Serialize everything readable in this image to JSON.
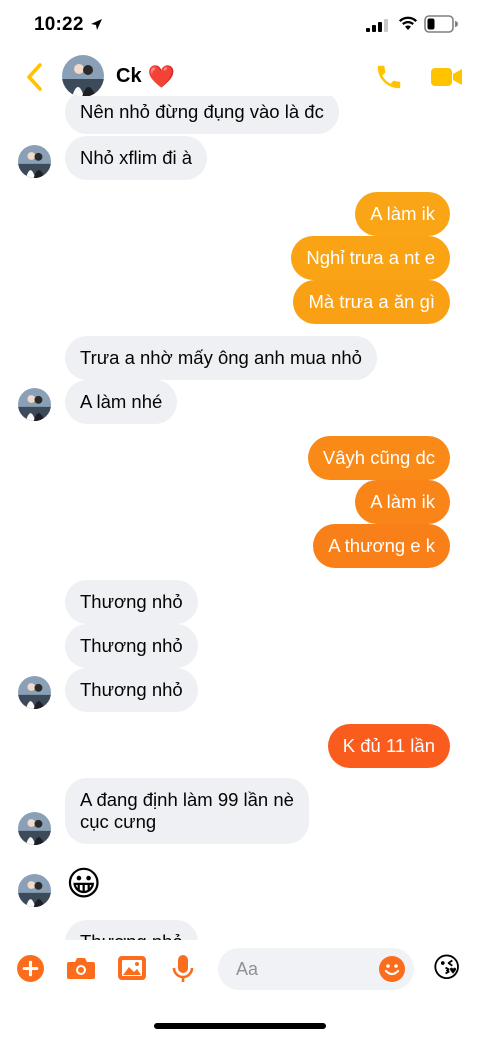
{
  "status": {
    "time": "10:22"
  },
  "header": {
    "contact_name": "Ck",
    "heart": "❤️"
  },
  "messages": [
    {
      "side": "in",
      "text": "Nên nhỏ đừng đụng vào là đc"
    },
    {
      "side": "in",
      "text": "Nhỏ xflim đi à"
    },
    {
      "side": "out",
      "text": "A làm ik"
    },
    {
      "side": "out",
      "text": "Nghỉ trưa a nt e"
    },
    {
      "side": "out",
      "text": "Mà trưa a ăn gì"
    },
    {
      "side": "in",
      "text": "Trưa a nhờ mấy ông anh mua nhỏ"
    },
    {
      "side": "in",
      "text": "A làm nhé"
    },
    {
      "side": "out",
      "text": "Vâyh cũng dc"
    },
    {
      "side": "out",
      "text": "A làm ik"
    },
    {
      "side": "out",
      "text": "A thương e k"
    },
    {
      "side": "in",
      "text": "Thương nhỏ"
    },
    {
      "side": "in",
      "text": "Thương nhỏ"
    },
    {
      "side": "in",
      "text": "Thương nhỏ"
    },
    {
      "side": "out",
      "text": "K đủ 11 lần"
    },
    {
      "side": "in",
      "text": "A đang định làm 99 lần nè",
      "text2": "cục cưng"
    },
    {
      "side": "in",
      "text": "😀"
    },
    {
      "side": "in",
      "text": "Thương nhỏ"
    }
  ],
  "composer": {
    "placeholder": "Aa",
    "emoji": "😘"
  },
  "colors": {
    "accent": "#ffc300",
    "incoming_bubble": "#eef0f3",
    "outgoing_top": "#f8a315",
    "outgoing_bottom": "#fa5a1e",
    "composer_icons": "#fb6d1c"
  },
  "icons": [
    "location-arrow-icon",
    "signal-icon",
    "wifi-icon",
    "battery-icon",
    "back-chevron-icon",
    "phone-icon",
    "video-camera-icon",
    "plus-icon",
    "camera-icon",
    "image-icon",
    "microphone-icon",
    "smile-icon"
  ]
}
